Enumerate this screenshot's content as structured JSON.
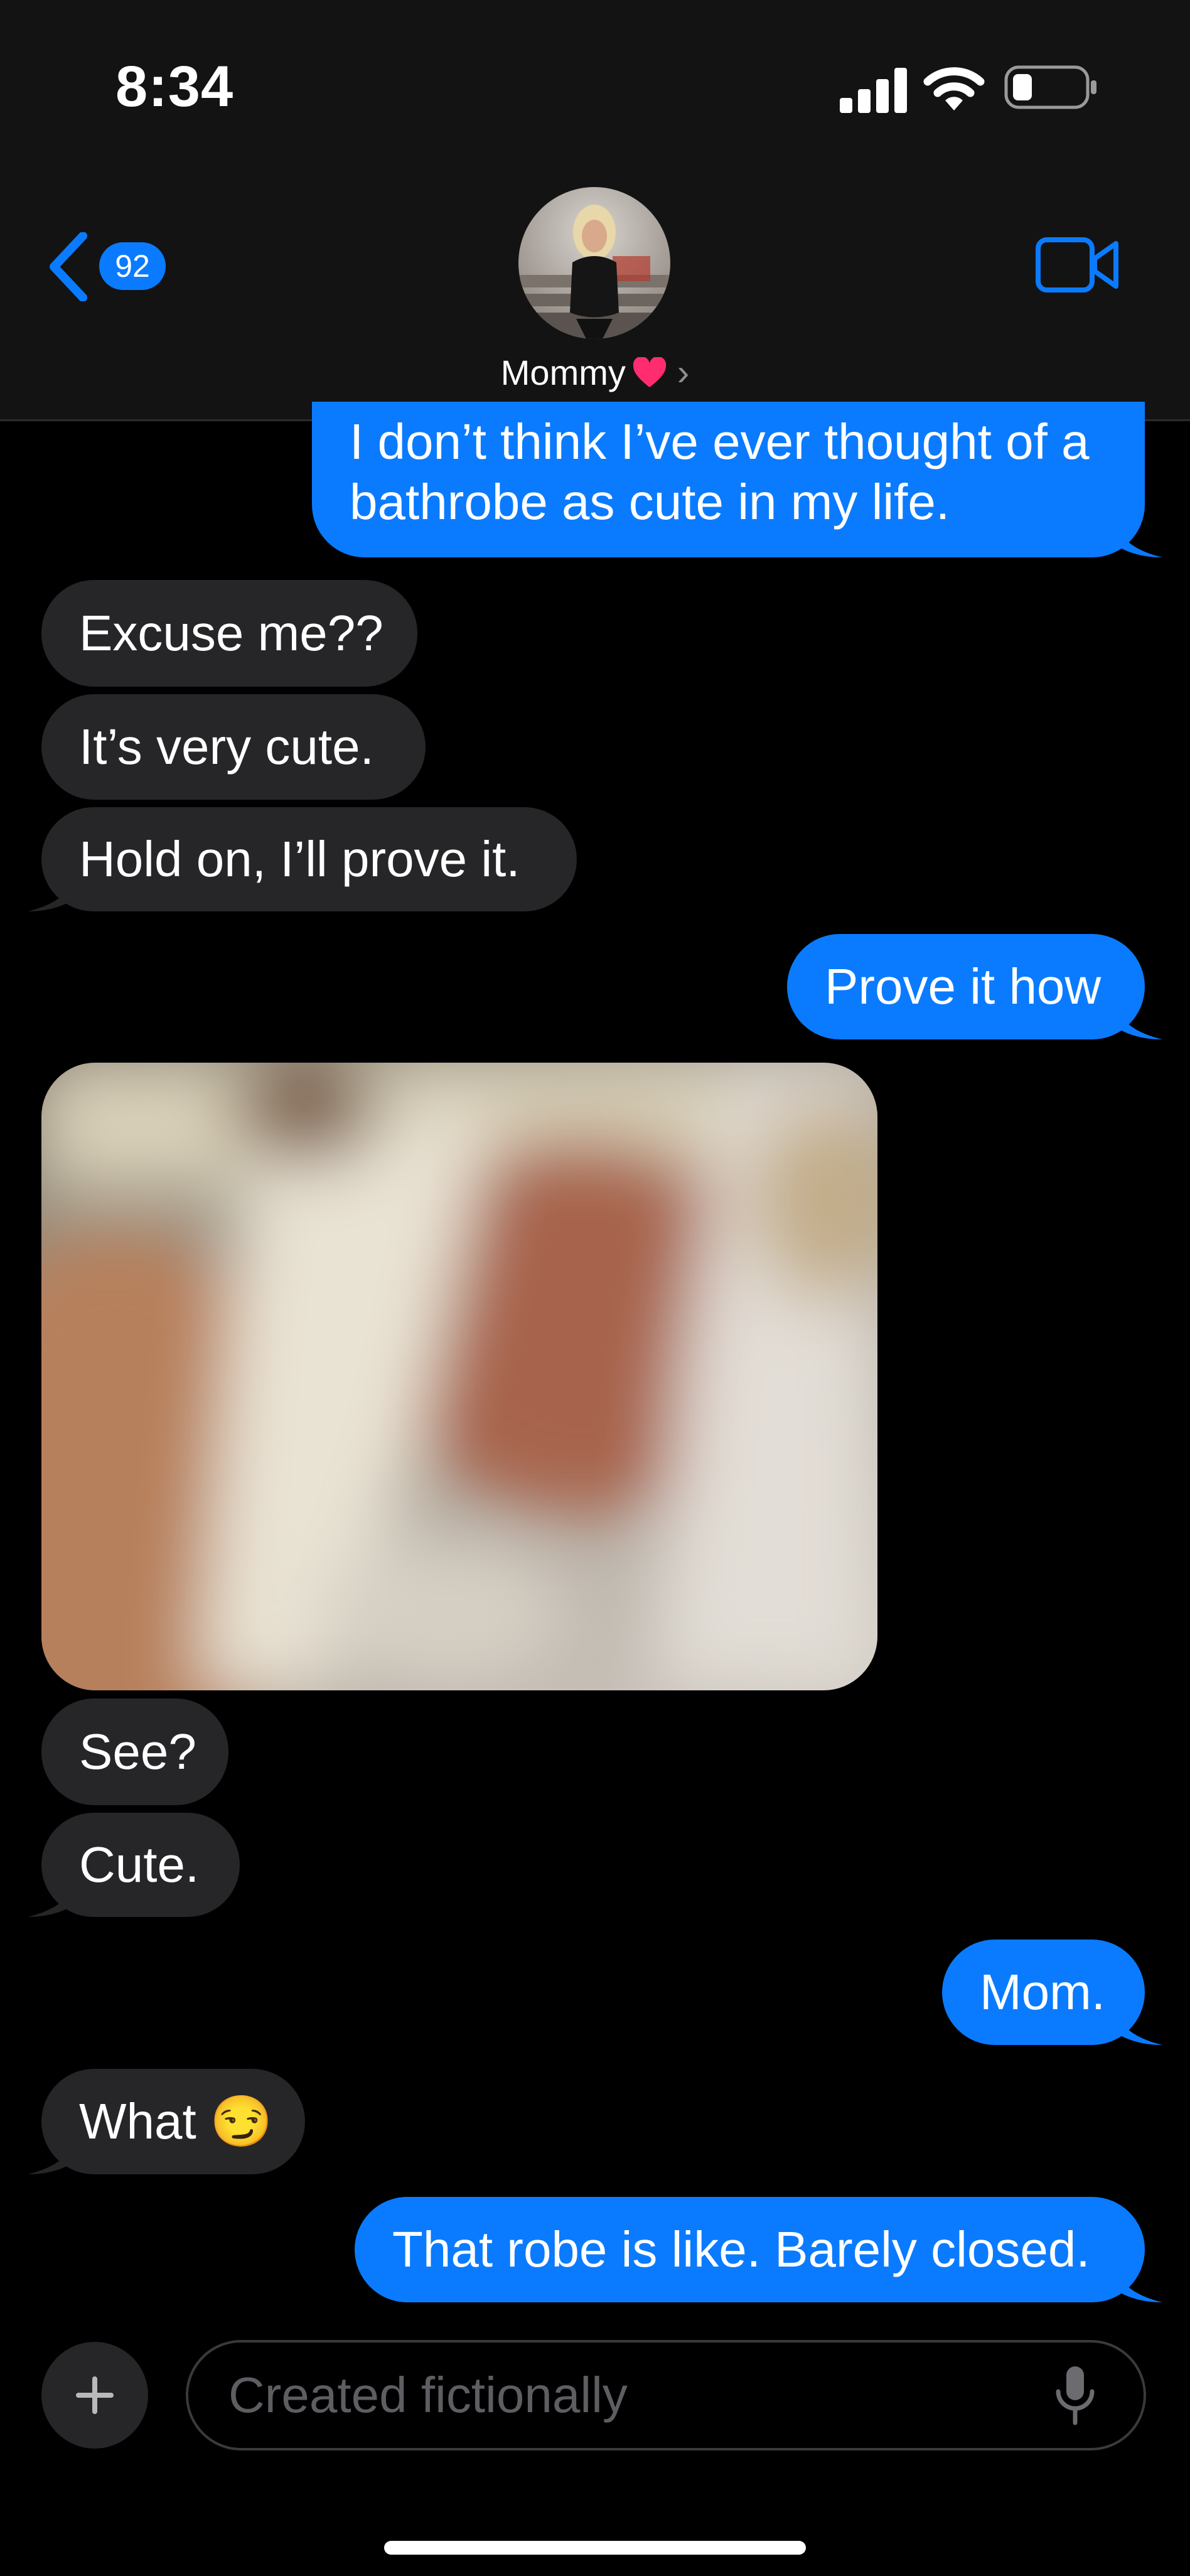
{
  "status_bar": {
    "time": "8:34"
  },
  "header": {
    "back_count": "92",
    "contact_name": "Mommy",
    "contact_emoji": "❤",
    "chevron": "›"
  },
  "messages": [
    {
      "from": "me",
      "text": "I don’t think I’ve ever thought of a bathrobe as cute in my life."
    },
    {
      "from": "them",
      "text": "Excuse me??"
    },
    {
      "from": "them",
      "text": "It’s very cute."
    },
    {
      "from": "them",
      "text": "Hold on, I’ll prove it."
    },
    {
      "from": "me",
      "text": "Prove it how"
    },
    {
      "from": "them",
      "type": "photo"
    },
    {
      "from": "them",
      "text": "See?"
    },
    {
      "from": "them",
      "text": "Cute."
    },
    {
      "from": "me",
      "text": "Mom."
    },
    {
      "from": "them",
      "text": "What",
      "emoji": "😏"
    },
    {
      "from": "me",
      "text": "That robe is like. Barely closed."
    }
  ],
  "composer": {
    "placeholder": "Created fictionally",
    "plus_icon": "plus-icon",
    "mic_icon": "microphone-icon"
  },
  "colors": {
    "outgoing_bubble": "#0a7bff",
    "incoming_bubble": "#262628",
    "header_background": "#131313",
    "background": "#000000"
  }
}
